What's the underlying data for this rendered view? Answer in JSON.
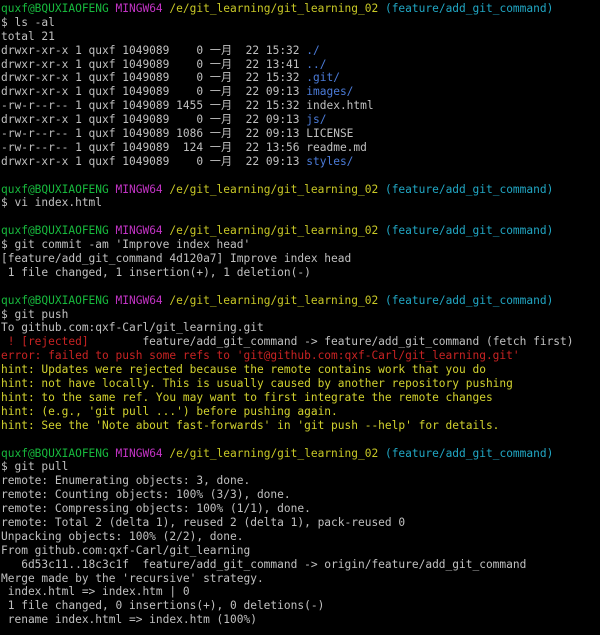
{
  "colors": {
    "default": "#c0c0c0",
    "prompt_user": "#17b93d",
    "prompt_env": "#c233c4",
    "prompt_path": "#c8c826",
    "prompt_branch": "#21a7c4",
    "directory": "#4b7bd8",
    "error": "#c82323",
    "hint": "#d2d22f",
    "background": "#000000"
  },
  "lines": [
    {
      "type": "prompt",
      "segments": [
        {
          "text": "quxf@BQUXIAOFENG",
          "color": "green"
        },
        {
          "text": " MINGW64",
          "color": "magenta"
        },
        {
          "text": " /e/git_learning/git_learning_02",
          "color": "yellow"
        },
        {
          "text": " (feature/add_git_command)",
          "color": "cyan"
        }
      ]
    },
    {
      "type": "command",
      "segments": [
        {
          "text": "$ ls -al",
          "color": "default"
        }
      ]
    },
    {
      "type": "output",
      "segments": [
        {
          "text": "total 21",
          "color": "default"
        }
      ]
    },
    {
      "type": "output",
      "segments": [
        {
          "text": "drwxr-xr-x 1 quxf 1049089    0 一月  22 15:32 ",
          "color": "default"
        },
        {
          "text": "./",
          "color": "blue"
        }
      ]
    },
    {
      "type": "output",
      "segments": [
        {
          "text": "drwxr-xr-x 1 quxf 1049089    0 一月  22 13:41 ",
          "color": "default"
        },
        {
          "text": "../",
          "color": "blue"
        }
      ]
    },
    {
      "type": "output",
      "segments": [
        {
          "text": "drwxr-xr-x 1 quxf 1049089    0 一月  22 15:32 ",
          "color": "default"
        },
        {
          "text": ".git/",
          "color": "blue"
        }
      ]
    },
    {
      "type": "output",
      "segments": [
        {
          "text": "drwxr-xr-x 1 quxf 1049089    0 一月  22 09:13 ",
          "color": "default"
        },
        {
          "text": "images/",
          "color": "blue"
        }
      ]
    },
    {
      "type": "output",
      "segments": [
        {
          "text": "-rw-r--r-- 1 quxf 1049089 1455 一月  22 15:32 index.html",
          "color": "default"
        }
      ]
    },
    {
      "type": "output",
      "segments": [
        {
          "text": "drwxr-xr-x 1 quxf 1049089    0 一月  22 09:13 ",
          "color": "default"
        },
        {
          "text": "js/",
          "color": "blue"
        }
      ]
    },
    {
      "type": "output",
      "segments": [
        {
          "text": "-rw-r--r-- 1 quxf 1049089 1086 一月  22 09:13 LICENSE",
          "color": "default"
        }
      ]
    },
    {
      "type": "output",
      "segments": [
        {
          "text": "-rw-r--r-- 1 quxf 1049089  124 一月  22 13:56 readme.md",
          "color": "default"
        }
      ]
    },
    {
      "type": "output",
      "segments": [
        {
          "text": "drwxr-xr-x 1 quxf 1049089    0 一月  22 09:13 ",
          "color": "default"
        },
        {
          "text": "styles/",
          "color": "blue"
        }
      ]
    },
    {
      "type": "blank",
      "segments": [
        {
          "text": "",
          "color": "default"
        }
      ]
    },
    {
      "type": "prompt",
      "segments": [
        {
          "text": "quxf@BQUXIAOFENG",
          "color": "green"
        },
        {
          "text": " MINGW64",
          "color": "magenta"
        },
        {
          "text": " /e/git_learning/git_learning_02",
          "color": "yellow"
        },
        {
          "text": " (feature/add_git_command)",
          "color": "cyan"
        }
      ]
    },
    {
      "type": "command",
      "segments": [
        {
          "text": "$ vi index.html",
          "color": "default"
        }
      ]
    },
    {
      "type": "blank",
      "segments": [
        {
          "text": "",
          "color": "default"
        }
      ]
    },
    {
      "type": "prompt",
      "segments": [
        {
          "text": "quxf@BQUXIAOFENG",
          "color": "green"
        },
        {
          "text": " MINGW64",
          "color": "magenta"
        },
        {
          "text": " /e/git_learning/git_learning_02",
          "color": "yellow"
        },
        {
          "text": " (feature/add_git_command)",
          "color": "cyan"
        }
      ]
    },
    {
      "type": "command",
      "segments": [
        {
          "text": "$ git commit -am 'Improve index head'",
          "color": "default"
        }
      ]
    },
    {
      "type": "output",
      "segments": [
        {
          "text": "[feature/add_git_command 4d120a7] Improve index head",
          "color": "default"
        }
      ]
    },
    {
      "type": "output",
      "segments": [
        {
          "text": " 1 file changed, 1 insertion(+), 1 deletion(-)",
          "color": "default"
        }
      ]
    },
    {
      "type": "blank",
      "segments": [
        {
          "text": "",
          "color": "default"
        }
      ]
    },
    {
      "type": "prompt",
      "segments": [
        {
          "text": "quxf@BQUXIAOFENG",
          "color": "green"
        },
        {
          "text": " MINGW64",
          "color": "magenta"
        },
        {
          "text": " /e/git_learning/git_learning_02",
          "color": "yellow"
        },
        {
          "text": " (feature/add_git_command)",
          "color": "cyan"
        }
      ]
    },
    {
      "type": "command",
      "segments": [
        {
          "text": "$ git push",
          "color": "default"
        }
      ]
    },
    {
      "type": "output",
      "segments": [
        {
          "text": "To github.com:qxf-Carl/git_learning.git",
          "color": "default"
        }
      ]
    },
    {
      "type": "output",
      "segments": [
        {
          "text": " ! [rejected]",
          "color": "red"
        },
        {
          "text": "        feature/add_git_command -> feature/add_git_command (fetch first)",
          "color": "default"
        }
      ]
    },
    {
      "type": "error",
      "segments": [
        {
          "text": "error: failed to push some refs to 'git@github.com:qxf-Carl/git_learning.git'",
          "color": "red"
        }
      ]
    },
    {
      "type": "hint",
      "segments": [
        {
          "text": "hint: Updates were rejected because the remote contains work that you do",
          "color": "hint"
        }
      ]
    },
    {
      "type": "hint",
      "segments": [
        {
          "text": "hint: not have locally. This is usually caused by another repository pushing",
          "color": "hint"
        }
      ]
    },
    {
      "type": "hint",
      "segments": [
        {
          "text": "hint: to the same ref. You may want to first integrate the remote changes",
          "color": "hint"
        }
      ]
    },
    {
      "type": "hint",
      "segments": [
        {
          "text": "hint: (e.g., 'git pull ...') before pushing again.",
          "color": "hint"
        }
      ]
    },
    {
      "type": "hint",
      "segments": [
        {
          "text": "hint: See the 'Note about fast-forwards' in 'git push --help' for details.",
          "color": "hint"
        }
      ]
    },
    {
      "type": "blank",
      "segments": [
        {
          "text": "",
          "color": "default"
        }
      ]
    },
    {
      "type": "prompt",
      "segments": [
        {
          "text": "quxf@BQUXIAOFENG",
          "color": "green"
        },
        {
          "text": " MINGW64",
          "color": "magenta"
        },
        {
          "text": " /e/git_learning/git_learning_02",
          "color": "yellow"
        },
        {
          "text": " (feature/add_git_command)",
          "color": "cyan"
        }
      ]
    },
    {
      "type": "command",
      "segments": [
        {
          "text": "$ git pull",
          "color": "default"
        }
      ]
    },
    {
      "type": "output",
      "segments": [
        {
          "text": "remote: Enumerating objects: 3, done.",
          "color": "default"
        }
      ]
    },
    {
      "type": "output",
      "segments": [
        {
          "text": "remote: Counting objects: 100% (3/3), done.",
          "color": "default"
        }
      ]
    },
    {
      "type": "output",
      "segments": [
        {
          "text": "remote: Compressing objects: 100% (1/1), done.",
          "color": "default"
        }
      ]
    },
    {
      "type": "output",
      "segments": [
        {
          "text": "remote: Total 2 (delta 1), reused 2 (delta 1), pack-reused 0",
          "color": "default"
        }
      ]
    },
    {
      "type": "output",
      "segments": [
        {
          "text": "Unpacking objects: 100% (2/2), done.",
          "color": "default"
        }
      ]
    },
    {
      "type": "output",
      "segments": [
        {
          "text": "From github.com:qxf-Carl/git_learning",
          "color": "default"
        }
      ]
    },
    {
      "type": "output",
      "segments": [
        {
          "text": "   6d53c11..18c3c1f  feature/add_git_command -> origin/feature/add_git_command",
          "color": "default"
        }
      ]
    },
    {
      "type": "output",
      "segments": [
        {
          "text": "Merge made by the 'recursive' strategy.",
          "color": "default"
        }
      ]
    },
    {
      "type": "output",
      "segments": [
        {
          "text": " index.html => index.htm | 0",
          "color": "default"
        }
      ]
    },
    {
      "type": "output",
      "segments": [
        {
          "text": " 1 file changed, 0 insertions(+), 0 deletions(-)",
          "color": "default"
        }
      ]
    },
    {
      "type": "output",
      "segments": [
        {
          "text": " rename index.html => index.htm (100%)",
          "color": "default"
        }
      ]
    }
  ]
}
